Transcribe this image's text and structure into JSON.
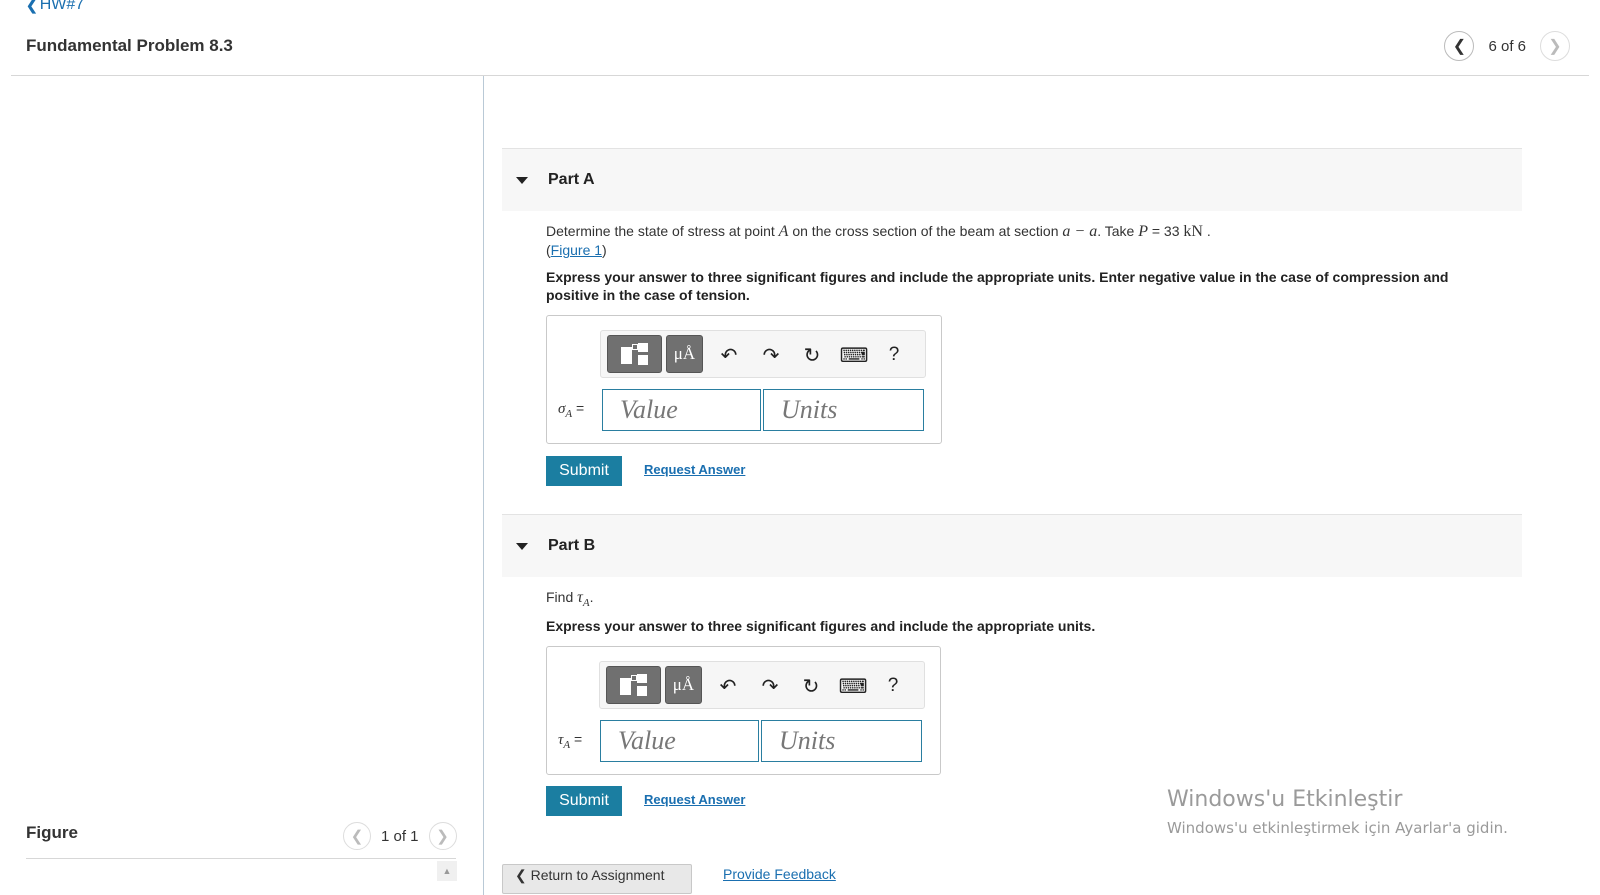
{
  "header": {
    "back_label": "HW#7",
    "title": "Fundamental Problem 8.3",
    "counter": "6 of 6"
  },
  "figure": {
    "label": "Figure",
    "counter": "1 of 1"
  },
  "part_a": {
    "title": "Part A",
    "question_pre": "Determine the state of stress at point ",
    "point": "A",
    "question_mid": " on the cross section of the beam at section ",
    "section": "a − a",
    "question_take": ". Take ",
    "load_symbol": "P",
    "load_value": " = 33 ",
    "load_unit": "kN",
    "question_end": " .",
    "figure_link": "Figure 1",
    "instructions": "Express your answer to three significant figures and include the appropriate units. Enter negative value in the case of compression and positive in the case of tension.",
    "variable": "σ",
    "subscript": "A",
    "equals": " =",
    "value_placeholder": "Value",
    "units_placeholder": "Units",
    "submit_label": "Submit",
    "request_label": "Request Answer"
  },
  "part_b": {
    "title": "Part B",
    "question_pre": "Find ",
    "variable": "τ",
    "subscript": "A",
    "question_end": ".",
    "instructions": "Express your answer to three significant figures and include the appropriate units.",
    "equals": " =",
    "value_placeholder": "Value",
    "units_placeholder": "Units",
    "submit_label": "Submit",
    "request_label": "Request Answer"
  },
  "toolbar": {
    "units_glyph": "μÅ",
    "undo_icon": "↶",
    "redo_icon": "↷",
    "reset_icon": "↻",
    "keyboard_icon": "⌨",
    "help_label": "?"
  },
  "footer": {
    "return_label": "Return to Assignment",
    "feedback_label": "Provide Feedback"
  },
  "watermark": {
    "line1": "Windows'u Etkinleştir",
    "line2": "Windows'u etkinleştirmek için Ayarlar'a gidin."
  },
  "colors": {
    "accent": "#1b7ea1",
    "link": "#1a6fb0",
    "header_bg": "#f7f7f7"
  }
}
